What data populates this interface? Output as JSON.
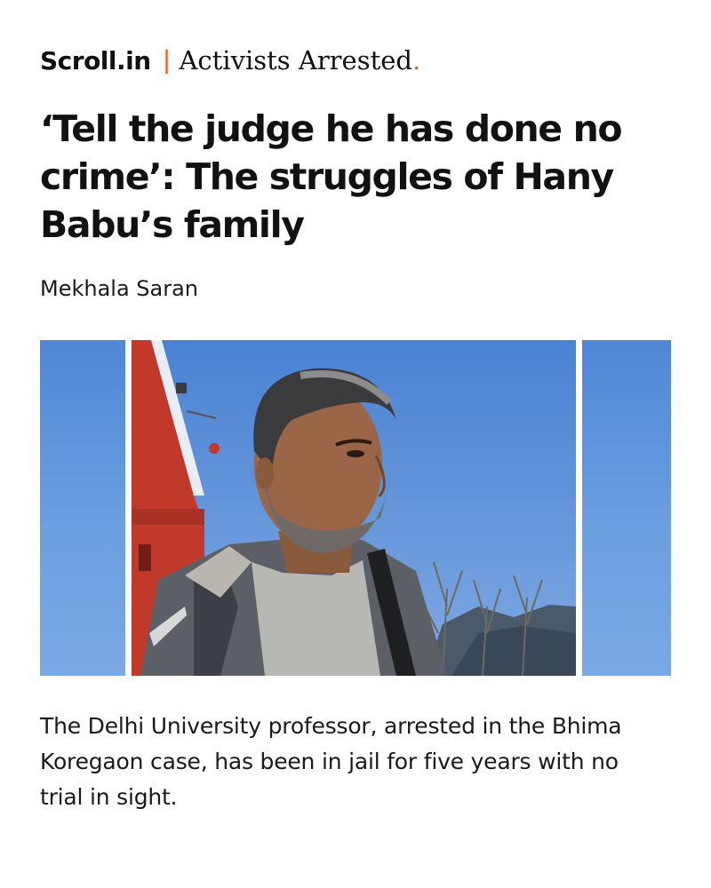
{
  "masthead": {
    "brand": "Scroll.in",
    "separator": "|",
    "section": "Activists Arrested",
    "section_dot": "."
  },
  "article": {
    "headline": "‘Tell the judge he has done no crime’: The struggles of Hany Babu’s family",
    "author": "Mekhala Saran",
    "dek": "The Delhi University professor, arrested in the Bhima Koregaon case, has been in jail for five years with no trial in sight."
  },
  "colors": {
    "accent": "#e8642c",
    "sky": "#5a8fdb",
    "text": "#111111"
  }
}
